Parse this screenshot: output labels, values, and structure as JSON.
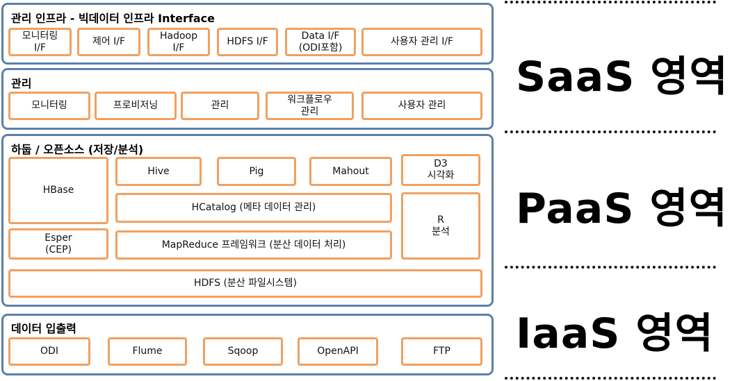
{
  "panels": [
    {
      "title": "관리 인프라 - 빅데이터 인프라 Interface",
      "boxes": [
        "모니터링\nI/F",
        "제어 I/F",
        "Hadoop\nI/F",
        "HDFS I/F",
        "Data I/F\n(ODI포함)",
        "사용자 관리 I/F"
      ]
    },
    {
      "title": "관리",
      "boxes": [
        "모니터링",
        "프로비저닝",
        "관리",
        "워크플로우\n관리",
        "사용자 관리"
      ]
    },
    {
      "title": "하둡 / 오픈소스 (저장/분석)",
      "boxes": [
        "HBase",
        "Hive",
        "Pig",
        "Mahout",
        "D3\n시각화",
        "HCatalog (메타 데이터 관리)",
        "R\n분석",
        "Esper\n(CEP)",
        "MapReduce 프레임워크 (분산 데이터 처리)",
        "HDFS (분산 파일시스템)"
      ]
    },
    {
      "title": "데이터 입출력",
      "boxes": [
        "ODI",
        "Flume",
        "Sqoop",
        "OpenAPI",
        "FTP"
      ]
    }
  ],
  "zones": [
    "SaaS 영역",
    "PaaS 영역",
    "IaaS 영역"
  ],
  "colors": {
    "panel_border": "#5b7faa",
    "box_border": "#f0a060"
  }
}
